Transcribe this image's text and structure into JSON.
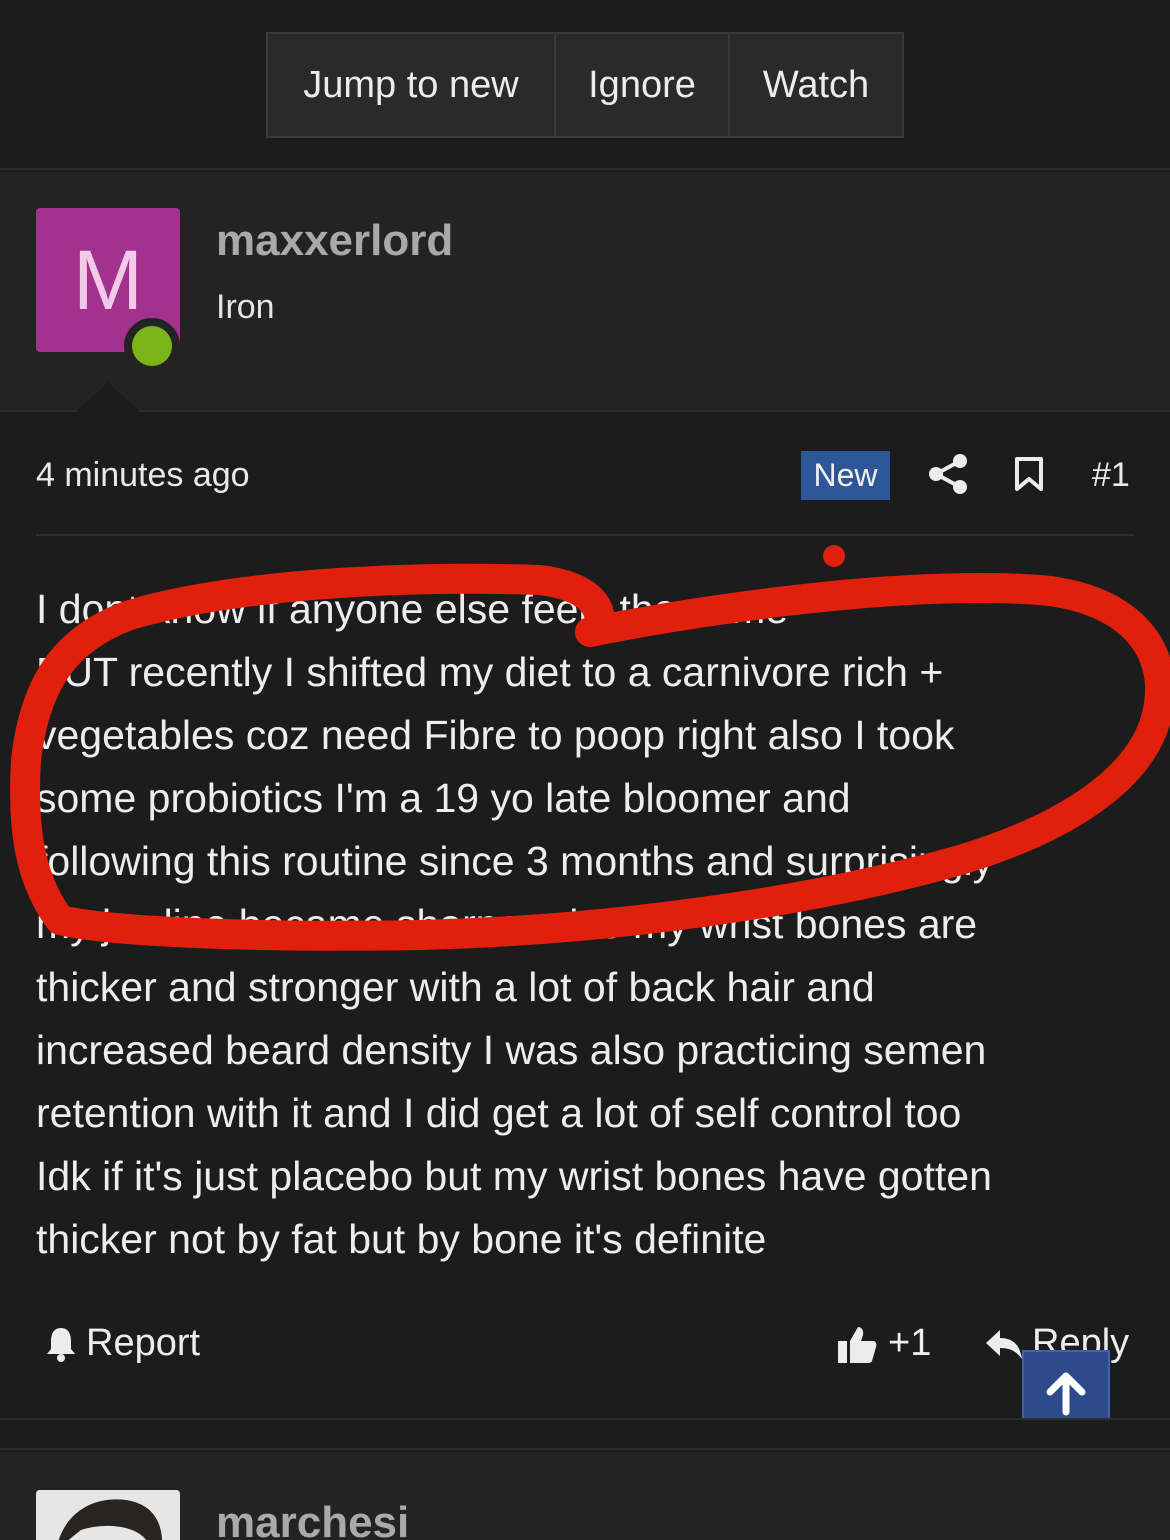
{
  "thread_actions": {
    "jump_label": "Jump to new",
    "ignore_label": "Ignore",
    "watch_label": "Watch"
  },
  "post": {
    "avatar_letter": "M",
    "username": "maxxerlord",
    "user_title": "Iron",
    "time": "4 minutes ago",
    "badge": "New",
    "number": "#1",
    "body_lines": [
      "I dont know if anyone else feels the same",
      "BUT recently I shifted my diet to a carnivore rich +",
      "vegetables coz need Fibre to poop right also I took",
      "some probiotics I'm a 19 yo late bloomer and",
      "following this routine since 3 months and surprisingly",
      "my jawline became sharper also my wrist bones are",
      "thicker and stronger with a lot of back hair and",
      "increased beard density I was also practicing semen",
      "retention with it and I did get a lot of self control too",
      "Idk if it's just placebo but my wrist bones have gotten",
      "thicker not by fat but by bone it's definite"
    ],
    "report_label": "Report",
    "like_label": "+1",
    "reply_label": "Reply"
  },
  "next_post": {
    "username": "marchesi"
  },
  "colors": {
    "background": "#1c1c1c",
    "panel": "#232323",
    "avatar": "#a3318e",
    "online": "#7cb518",
    "accent": "#2d5796",
    "annotation": "#e0200c"
  },
  "icons": [
    "share-icon",
    "bookmark-icon",
    "bell-icon",
    "thumbs-up-icon",
    "reply-icon",
    "arrow-up-icon"
  ]
}
